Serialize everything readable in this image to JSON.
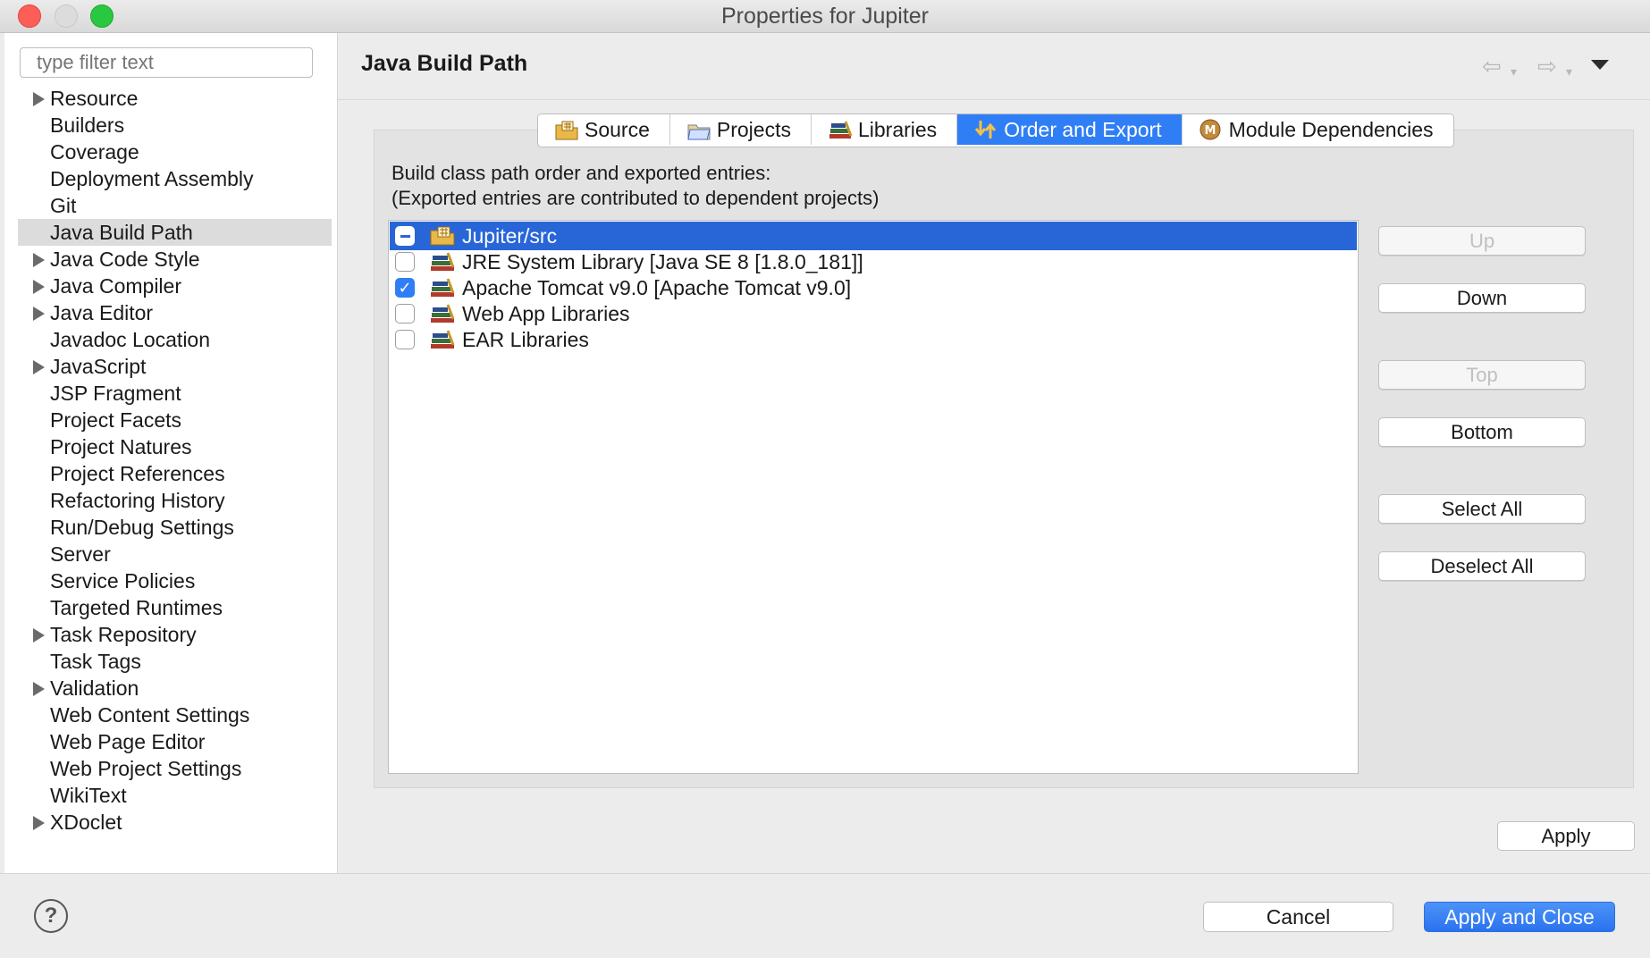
{
  "window": {
    "title": "Properties for Jupiter"
  },
  "sidebar": {
    "filter_placeholder": "type filter text",
    "items": [
      {
        "label": "Resource",
        "expandable": true
      },
      {
        "label": "Builders",
        "expandable": false
      },
      {
        "label": "Coverage",
        "expandable": false
      },
      {
        "label": "Deployment Assembly",
        "expandable": false
      },
      {
        "label": "Git",
        "expandable": false
      },
      {
        "label": "Java Build Path",
        "expandable": false,
        "selected": true
      },
      {
        "label": "Java Code Style",
        "expandable": true
      },
      {
        "label": "Java Compiler",
        "expandable": true
      },
      {
        "label": "Java Editor",
        "expandable": true
      },
      {
        "label": "Javadoc Location",
        "expandable": false
      },
      {
        "label": "JavaScript",
        "expandable": true
      },
      {
        "label": "JSP Fragment",
        "expandable": false
      },
      {
        "label": "Project Facets",
        "expandable": false
      },
      {
        "label": "Project Natures",
        "expandable": false
      },
      {
        "label": "Project References",
        "expandable": false
      },
      {
        "label": "Refactoring History",
        "expandable": false
      },
      {
        "label": "Run/Debug Settings",
        "expandable": false
      },
      {
        "label": "Server",
        "expandable": false
      },
      {
        "label": "Service Policies",
        "expandable": false
      },
      {
        "label": "Targeted Runtimes",
        "expandable": false
      },
      {
        "label": "Task Repository",
        "expandable": true
      },
      {
        "label": "Task Tags",
        "expandable": false
      },
      {
        "label": "Validation",
        "expandable": true
      },
      {
        "label": "Web Content Settings",
        "expandable": false
      },
      {
        "label": "Web Page Editor",
        "expandable": false
      },
      {
        "label": "Web Project Settings",
        "expandable": false
      },
      {
        "label": "WikiText",
        "expandable": false
      },
      {
        "label": "XDoclet",
        "expandable": true
      }
    ]
  },
  "page": {
    "title": "Java Build Path",
    "tabs": [
      {
        "label": "Source",
        "icon": "source-folder-icon",
        "active": false
      },
      {
        "label": "Projects",
        "icon": "projects-folder-icon",
        "active": false
      },
      {
        "label": "Libraries",
        "icon": "libraries-icon",
        "active": false
      },
      {
        "label": "Order and Export",
        "icon": "order-export-icon",
        "active": true
      },
      {
        "label": "Module Dependencies",
        "icon": "module-icon",
        "active": false
      }
    ],
    "description_line1": "Build class path order and exported entries:",
    "description_line2": "(Exported entries are contributed to dependent projects)",
    "entries": [
      {
        "label": "Jupiter/src",
        "state": "mixed",
        "icon": "package-folder-icon",
        "selected": true
      },
      {
        "label": "JRE System Library [Java SE 8 [1.8.0_181]]",
        "state": "unchecked",
        "icon": "library-icon",
        "selected": false
      },
      {
        "label": "Apache Tomcat v9.0 [Apache Tomcat v9.0]",
        "state": "checked",
        "icon": "library-icon",
        "selected": false
      },
      {
        "label": "Web App Libraries",
        "state": "unchecked",
        "icon": "library-icon",
        "selected": false
      },
      {
        "label": "EAR Libraries",
        "state": "unchecked",
        "icon": "library-icon",
        "selected": false
      }
    ],
    "buttons": {
      "up": "Up",
      "down": "Down",
      "top": "Top",
      "bottom": "Bottom",
      "select_all": "Select All",
      "deselect_all": "Deselect All"
    },
    "apply": "Apply"
  },
  "footer": {
    "help": "?",
    "cancel": "Cancel",
    "apply_and_close": "Apply and Close"
  },
  "colors": {
    "accent": "#2f7ef6",
    "selection": "#2866d8"
  }
}
